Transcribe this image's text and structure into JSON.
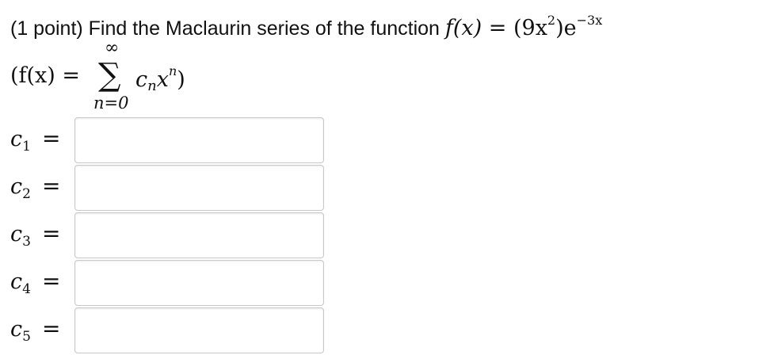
{
  "question": {
    "prefix": "(1 point) Find the Maclaurin series of the function ",
    "func_name": "f(x)",
    "equals": " = (9x",
    "exp2": "2",
    "close": ")e",
    "exp": "−3x"
  },
  "series": {
    "lhs": "(f(x) = ",
    "upper_limit": "∞",
    "sigma": "∑",
    "lower_limit": "n=0",
    "coef": "c",
    "coef_sub": "n",
    "var": "x",
    "var_sup": "n",
    "close": ")"
  },
  "coefficients": [
    {
      "label": "c",
      "index": "1",
      "value": ""
    },
    {
      "label": "c",
      "index": "2",
      "value": ""
    },
    {
      "label": "c",
      "index": "3",
      "value": ""
    },
    {
      "label": "c",
      "index": "4",
      "value": ""
    },
    {
      "label": "c",
      "index": "5",
      "value": ""
    }
  ],
  "equals_sign": "="
}
